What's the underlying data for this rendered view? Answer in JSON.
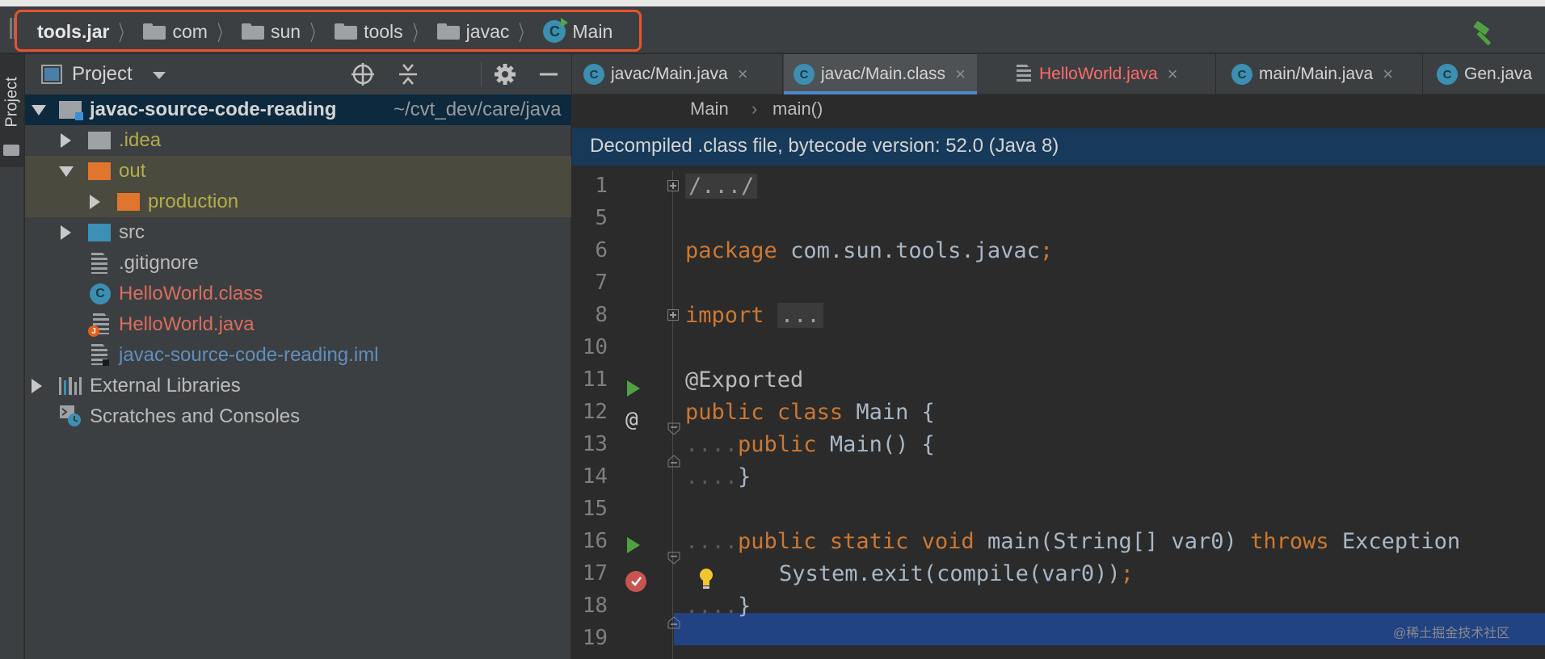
{
  "breadcrumbs": [
    {
      "label": "tools.jar",
      "icon": "jar-icon"
    },
    {
      "label": "com",
      "icon": "package-folder-icon"
    },
    {
      "label": "sun",
      "icon": "package-folder-icon"
    },
    {
      "label": "tools",
      "icon": "package-folder-icon"
    },
    {
      "label": "javac",
      "icon": "package-folder-icon"
    },
    {
      "label": "Main",
      "icon": "class-icon"
    }
  ],
  "icons": {
    "class_letter": "C",
    "java_letter": "J"
  },
  "tool_strip": {
    "project_tab": "Project"
  },
  "project_panel": {
    "title": "Project",
    "tree": {
      "root_name": "javac-source-code-reading",
      "root_path": "~/cvt_dev/care/java",
      "items": [
        {
          "label": ".idea",
          "color": "#b2ad4a"
        },
        {
          "label": "out",
          "color": "#b2ad4a"
        },
        {
          "label": "production",
          "color": "#b2ad4a"
        },
        {
          "label": "src",
          "color": "#bbbbbb"
        },
        {
          "label": ".gitignore",
          "color": "#bbbbbb"
        },
        {
          "label": "HelloWorld.class",
          "color": "#d86d5e"
        },
        {
          "label": "HelloWorld.java",
          "color": "#d86d5e"
        },
        {
          "label": "javac-source-code-reading.iml",
          "color": "#5f8fbf"
        },
        {
          "label": "External Libraries",
          "color": "#bbbbbb"
        },
        {
          "label": "Scratches and Consoles",
          "color": "#bbbbbb"
        }
      ]
    }
  },
  "editor": {
    "tabs": [
      {
        "label": "javac/Main.java"
      },
      {
        "label": "javac/Main.class"
      },
      {
        "label": "HelloWorld.java"
      },
      {
        "label": "main/Main.java"
      },
      {
        "label": "Gen.java"
      }
    ],
    "close_glyph": "×",
    "crumb": {
      "class_name": "Main",
      "sep": "›",
      "method": "main()"
    },
    "banner": "Decompiled .class file, bytecode version: 52.0 (Java 8)",
    "line_numbers": [
      "1",
      "5",
      "6",
      "7",
      "8",
      "10",
      "11",
      "12",
      "13",
      "14",
      "15",
      "16",
      "17",
      "18",
      "19"
    ],
    "code": {
      "l1": "/.../",
      "l6_kw": "package",
      "l6_rest": "com.sun.tools.javac",
      "l6_semi": ";",
      "l8_kw": "import",
      "l8_fold": "...",
      "l11": "@Exported",
      "l12_kw1": "public",
      "l12_kw2": "class",
      "l12_rest": "Main {",
      "l13_kw": "public",
      "l13_rest": "Main() {",
      "l14": "}",
      "l16_kw1": "public",
      "l16_kw2": "static",
      "l16_kw3": "void",
      "l16_rest": "main(String[] var0)",
      "l16_kw4": "throws",
      "l16_tail": "Exception",
      "l17": "System.exit(compile(var0))",
      "l17_semi": ";",
      "l18": "}"
    }
  },
  "watermark": "@稀土掘金技术社区",
  "colors": {
    "accent_border": "#e8532d",
    "selection": "#214283",
    "keyword": "#cc7832",
    "run": "#4ea340",
    "breakpoint": "#c75450"
  }
}
